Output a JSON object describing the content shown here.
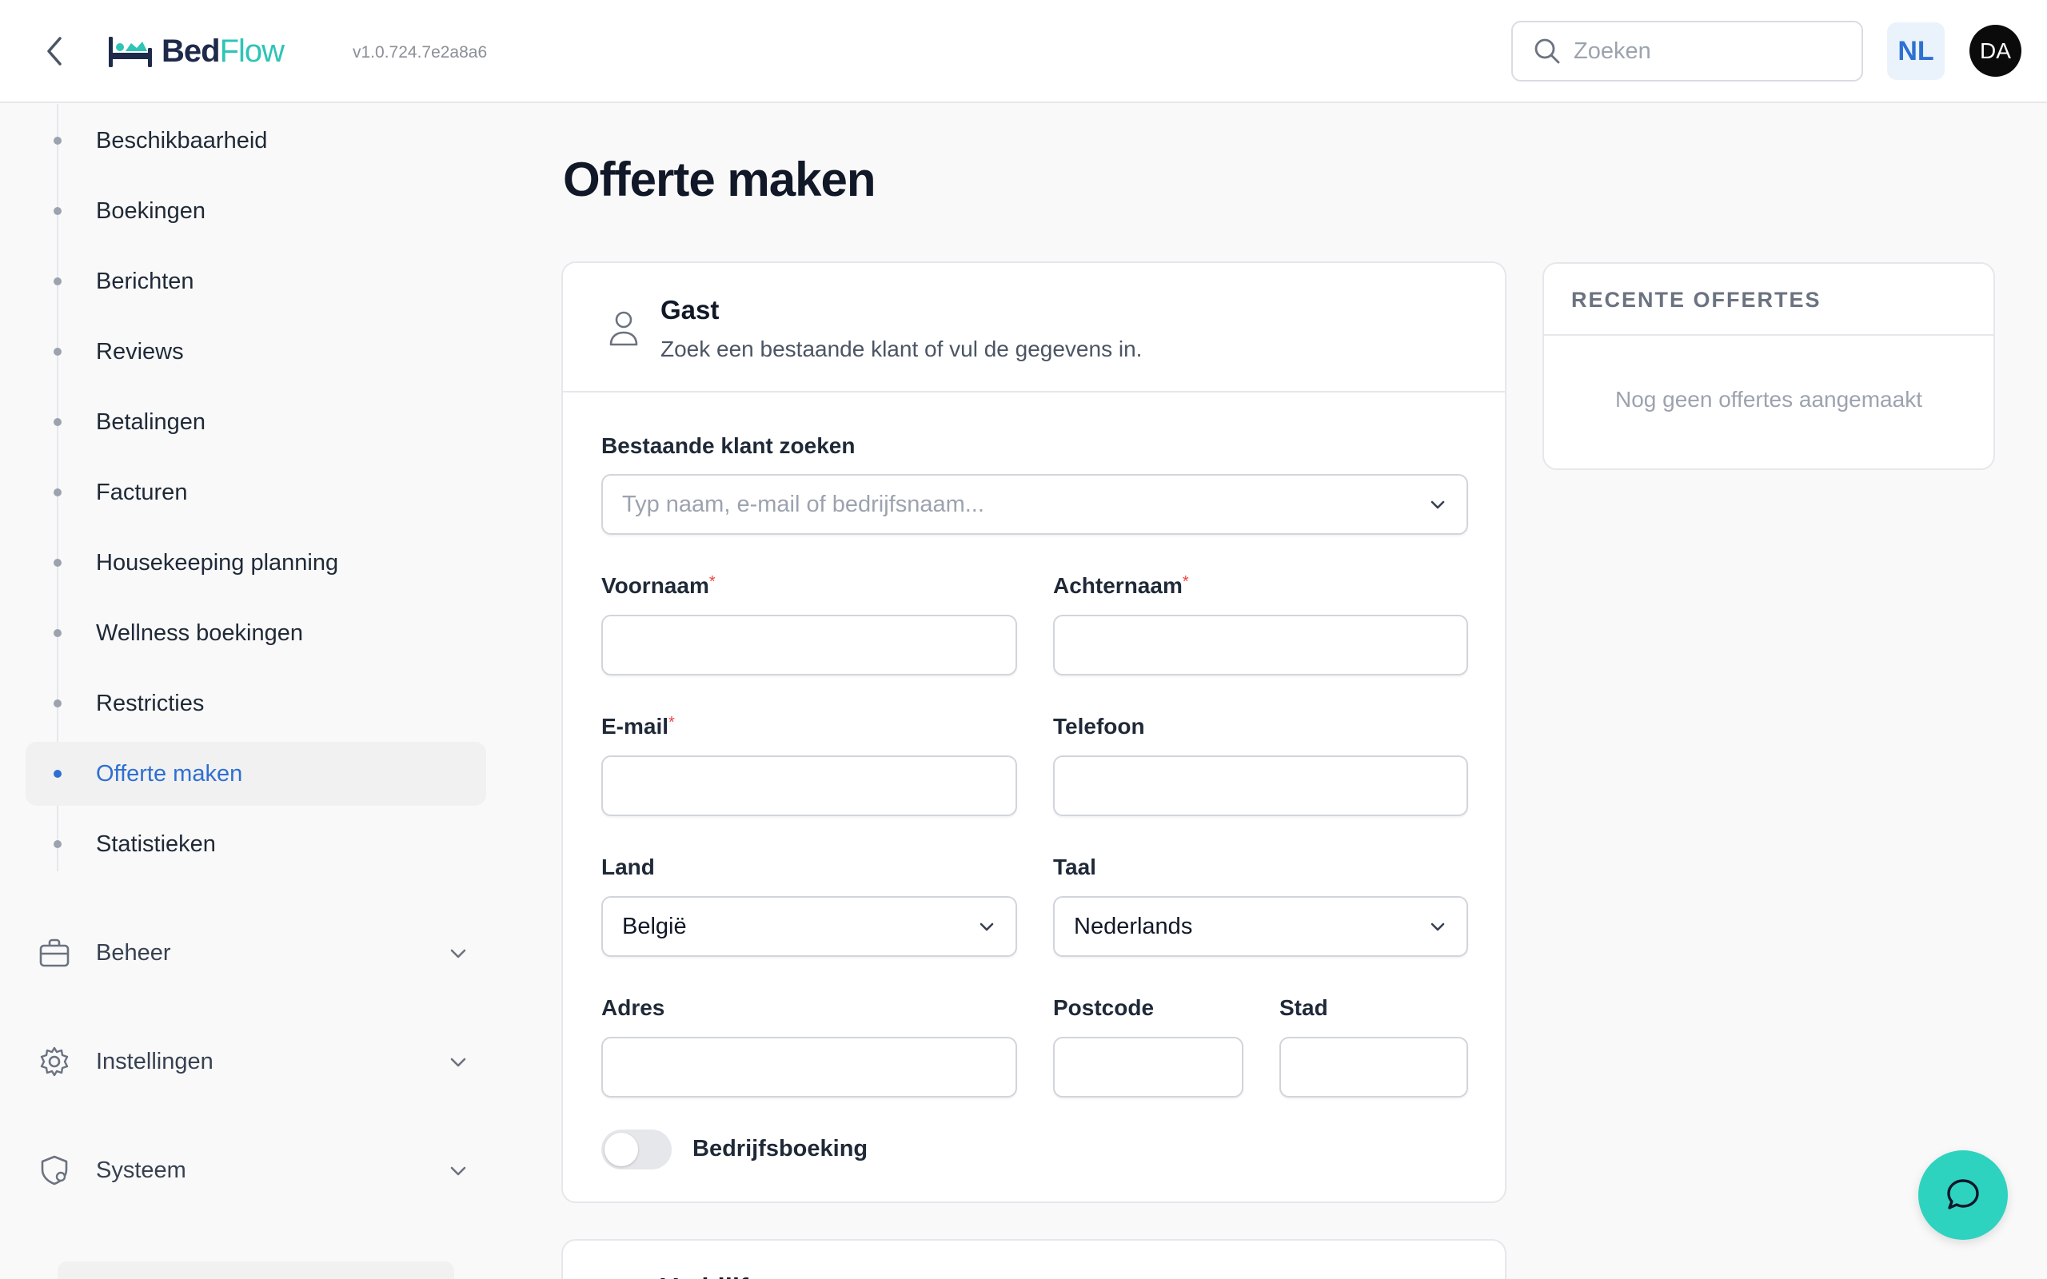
{
  "header": {
    "logo_part1": "Bed",
    "logo_part2": "Flow",
    "version": "v1.0.724.7e2a8a6",
    "search_placeholder": "Zoeken",
    "language": "NL",
    "avatar_initials": "DA"
  },
  "sidebar": {
    "items": [
      {
        "label": "Beschikbaarheid"
      },
      {
        "label": "Boekingen"
      },
      {
        "label": "Berichten"
      },
      {
        "label": "Reviews"
      },
      {
        "label": "Betalingen"
      },
      {
        "label": "Facturen"
      },
      {
        "label": "Housekeeping planning"
      },
      {
        "label": "Wellness boekingen"
      },
      {
        "label": "Restricties"
      },
      {
        "label": "Offerte maken"
      },
      {
        "label": "Statistieken"
      }
    ],
    "groups": [
      {
        "label": "Beheer"
      },
      {
        "label": "Instellingen"
      },
      {
        "label": "Systeem"
      }
    ]
  },
  "main": {
    "title": "Offerte maken",
    "guest": {
      "title": "Gast",
      "subtitle": "Zoek een bestaande klant of vul de gegevens in.",
      "search_label": "Bestaande klant zoeken",
      "search_placeholder": "Typ naam, e-mail of bedrijfsnaam...",
      "firstname_label": "Voornaam",
      "lastname_label": "Achternaam",
      "email_label": "E-mail",
      "phone_label": "Telefoon",
      "country_label": "Land",
      "country_value": "België",
      "language_label": "Taal",
      "language_value": "Nederlands",
      "address_label": "Adres",
      "postcode_label": "Postcode",
      "city_label": "Stad",
      "required_mark": "*",
      "company_label": "Bedrijfsboeking",
      "company_on": false
    },
    "next_section_title": "Verblijf"
  },
  "recent": {
    "title": "RECENTE OFFERTES",
    "empty": "Nog geen offertes aangemaakt"
  }
}
